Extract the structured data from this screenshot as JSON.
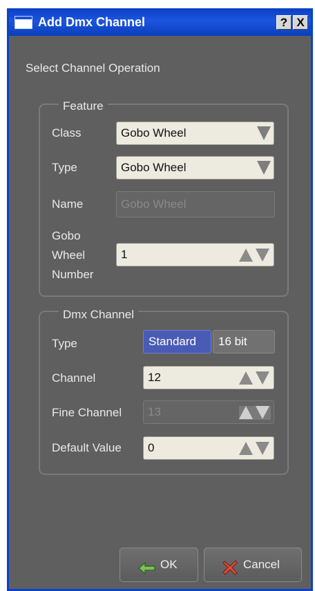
{
  "window": {
    "title": "Add Dmx Channel",
    "help_label": "?",
    "close_label": "X"
  },
  "intro": "Select Channel Operation",
  "feature": {
    "group_title": "Feature",
    "class_label": "Class",
    "class_value": "Gobo Wheel",
    "type_label": "Type",
    "type_value": "Gobo Wheel",
    "name_label": "Name",
    "name_placeholder": "Gobo Wheel",
    "wheel_number_label": [
      "Gobo",
      "Wheel",
      "Number"
    ],
    "wheel_number_value": "1"
  },
  "dmx": {
    "group_title": "Dmx Channel",
    "type_label": "Type",
    "type_options": [
      "Standard",
      "16 bit"
    ],
    "type_selected": "Standard",
    "channel_label": "Channel",
    "channel_value": "12",
    "fine_label": "Fine Channel",
    "fine_value": "13",
    "default_label": "Default Value",
    "default_value": "0"
  },
  "buttons": {
    "ok": "OK",
    "cancel": "Cancel"
  },
  "colors": {
    "title_bar": "#0a43c8",
    "panel": "#5f5f5f",
    "selected": "#4a5bb5"
  }
}
